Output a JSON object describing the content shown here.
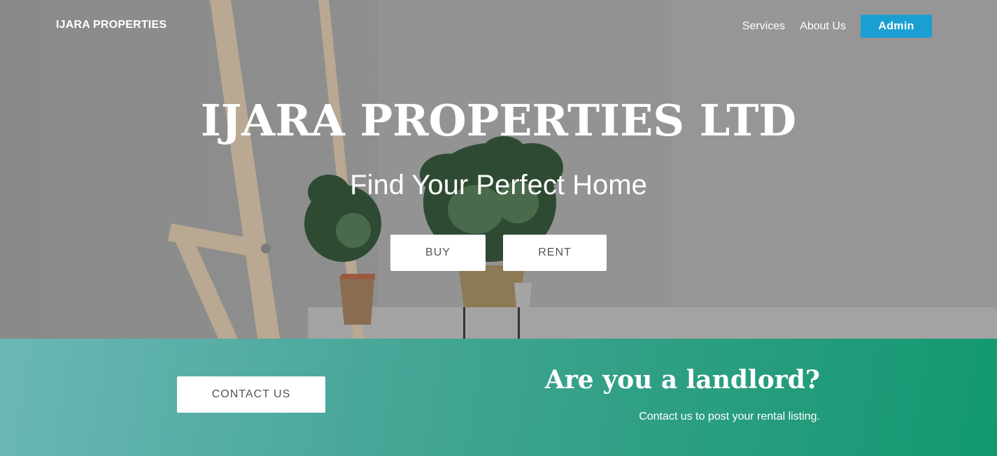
{
  "nav": {
    "logo": "IJARA PROPERTIES",
    "links": [
      "Services",
      "About Us"
    ],
    "admin_label": "Admin"
  },
  "hero": {
    "title": "IJARA PROPERTIES LTD",
    "subtitle": "Find Your Perfect Home",
    "buy_label": "BUY",
    "rent_label": "RENT"
  },
  "landlord": {
    "contact_label": "CONTACT US",
    "title": "Are you a landlord?",
    "text": "Contact us to post your rental listing."
  },
  "colors": {
    "admin_button": "#1a9fd2",
    "band_start": "#6bb8b6",
    "band_end": "#129870"
  }
}
